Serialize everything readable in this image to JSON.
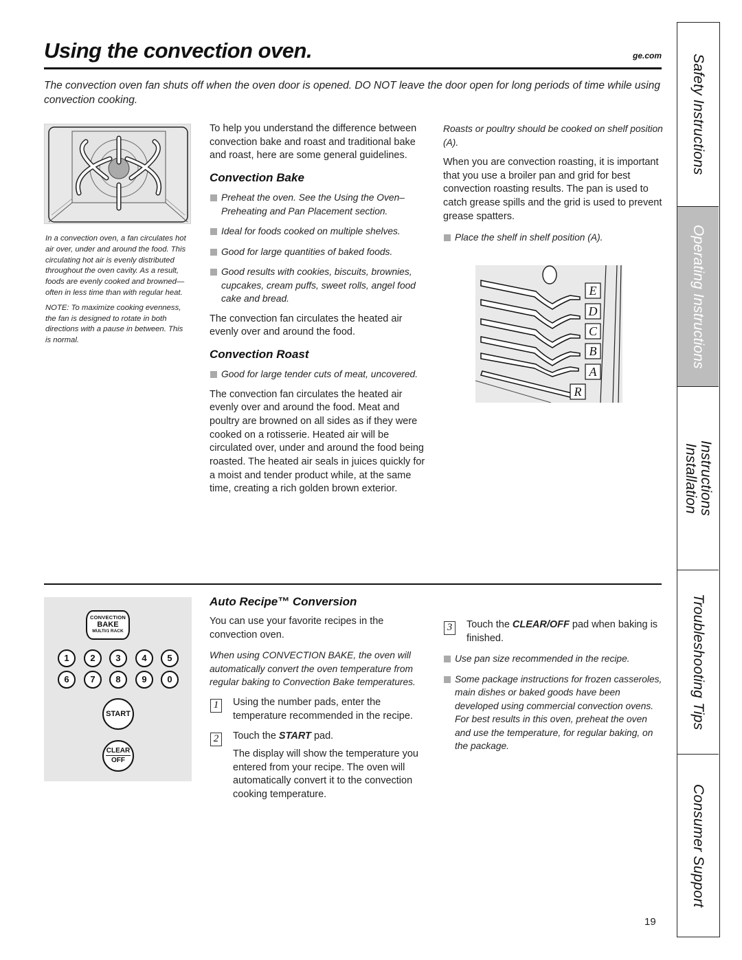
{
  "header": {
    "title": "Using the convection oven.",
    "site": "ge.com"
  },
  "intro": "The convection oven fan shuts off when the oven door is opened. DO NOT leave the door open for long periods of time while using convection cooking.",
  "left": {
    "figure_label": "convection-oven-airflow-illustration",
    "caption": "In a convection oven, a fan circulates hot air over, under and around the food. This circulating hot air is evenly distributed throughout the oven cavity. As a result, foods are evenly cooked and browned—often in less time than with regular heat.",
    "note": "NOTE: To maximize cooking evenness, the fan is designed to rotate in both directions with a pause in between. This is normal."
  },
  "middle": {
    "intro": "To help you understand the difference between convection bake and roast and traditional bake and roast, here are some general guidelines.",
    "bake": {
      "heading": "Convection Bake",
      "bullets": [
        "Preheat the oven. See the Using the Oven–Preheating and Pan Placement section.",
        "Ideal for foods cooked on multiple shelves.",
        "Good for large quantities of baked foods.",
        "Good results with cookies, biscuits, brownies, cupcakes, cream puffs, sweet rolls, angel food cake and bread."
      ],
      "body": "The convection fan circulates the heated air evenly over and around the food."
    },
    "roast": {
      "heading": "Convection Roast",
      "bullets": [
        "Good for large tender cuts of meat, uncovered."
      ],
      "body": "The convection fan circulates the heated air evenly over and around the food. Meat and poultry are browned on all sides as if they were cooked on a rotisserie. Heated air will be circulated over, under and around the food being roasted. The heated air seals in juices quickly for a moist and tender product while, at the same time, creating a rich golden brown exterior."
    }
  },
  "right": {
    "italic_note": "Roasts or poultry should be cooked on shelf position (A).",
    "body": "When you are convection roasting, it is important that you use a broiler pan and grid for best convection roasting results. The pan is used to catch grease spills and the grid is used to prevent grease spatters.",
    "bullets": [
      "Place the shelf in shelf position (A)."
    ],
    "shelf_labels": [
      "E",
      "D",
      "C",
      "B",
      "A",
      "R"
    ]
  },
  "auto_recipe": {
    "heading": "Auto Recipe™ Conversion",
    "intro": "You can use your favorite recipes in the convection oven.",
    "italic": "When using CONVECTION BAKE, the oven will automatically convert the oven temperature from regular baking to Convection Bake temperatures.",
    "steps": [
      {
        "num": "1",
        "pre": "Using the number pads, enter the temperature recommended in the recipe.",
        "bold": "",
        "post": ""
      },
      {
        "num": "2",
        "pre": "Touch the ",
        "bold": "START",
        "post": " pad."
      },
      {
        "num": "3",
        "pre": "Touch the ",
        "bold": "CLEAR/OFF",
        "post": " pad when baking is finished."
      }
    ],
    "step2_followup": "The display will show the temperature you entered from your recipe. The oven will automatically convert it to the convection cooking temperature.",
    "bullets": [
      "Use pan size recommended in the recipe.",
      "Some package instructions for frozen casseroles, main dishes or baked goods have been developed using commercial convection ovens. For best results in this oven, preheat the oven and use the temperature, for regular baking, on the package."
    ]
  },
  "control_panel": {
    "convection_pad": {
      "line1": "CONVECTION",
      "line2": "BAKE",
      "line3": "MULTI/1 RACK"
    },
    "number_pads": [
      "1",
      "2",
      "3",
      "4",
      "5",
      "6",
      "7",
      "8",
      "9",
      "0"
    ],
    "start_label": "START",
    "clear_label": "CLEAR",
    "off_label": "OFF"
  },
  "side_tabs": [
    {
      "label": "Safety Instructions",
      "active": false
    },
    {
      "label": "Operating Instructions",
      "active": true
    },
    {
      "label": "Installation Instructions",
      "line1": "Installation",
      "line2": "Instructions",
      "active": false
    },
    {
      "label": "Troubleshooting Tips",
      "active": false
    },
    {
      "label": "Consumer Support",
      "active": false
    }
  ],
  "page_number": "19",
  "colors": {
    "text": "#1a1a1a",
    "bullet_square": "#aaaaaa",
    "figure_bg": "#e6e6e6",
    "active_tab_bg": "#bdbdbd",
    "active_tab_text": "#ffffff"
  }
}
